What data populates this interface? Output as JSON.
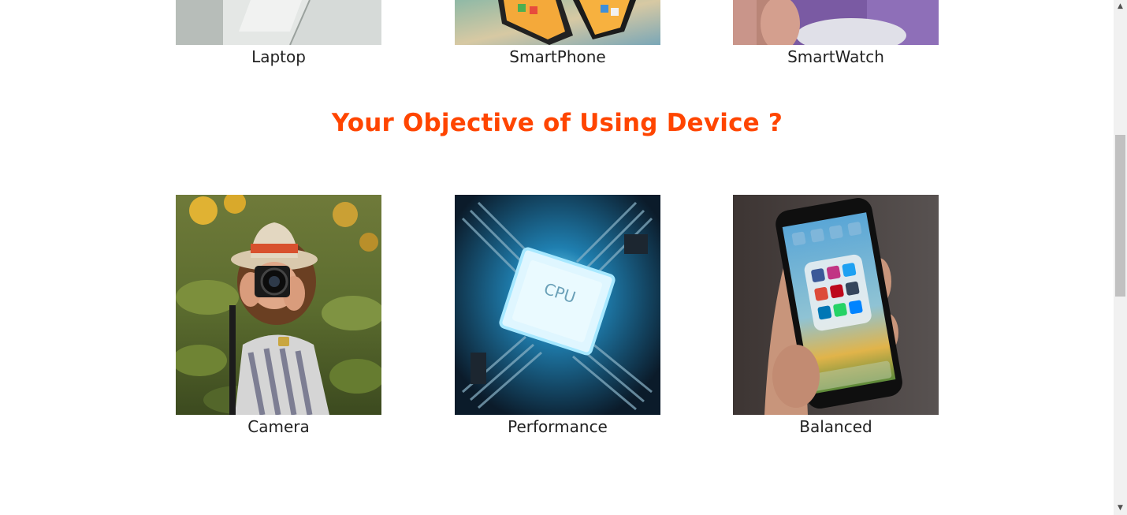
{
  "device_row": {
    "items": [
      {
        "label": "Laptop",
        "image": "laptop-photo"
      },
      {
        "label": "SmartPhone",
        "image": "smartphone-photo"
      },
      {
        "label": "SmartWatch",
        "image": "smartwatch-photo"
      }
    ]
  },
  "objective_section": {
    "heading": "Your Objective of Using Device ?",
    "items": [
      {
        "label": "Camera",
        "image": "photographer-with-camera-photo"
      },
      {
        "label": "Performance",
        "image": "cpu-chip-photo",
        "chip_text": "CPU"
      },
      {
        "label": "Balanced",
        "image": "phone-in-hand-social-apps-photo"
      }
    ]
  },
  "colors": {
    "heading": "#ff4500",
    "label": "#222222",
    "background": "#ffffff"
  },
  "scrollbar": {
    "up_icon": "up-arrow-icon",
    "down_icon": "down-arrow-icon"
  }
}
